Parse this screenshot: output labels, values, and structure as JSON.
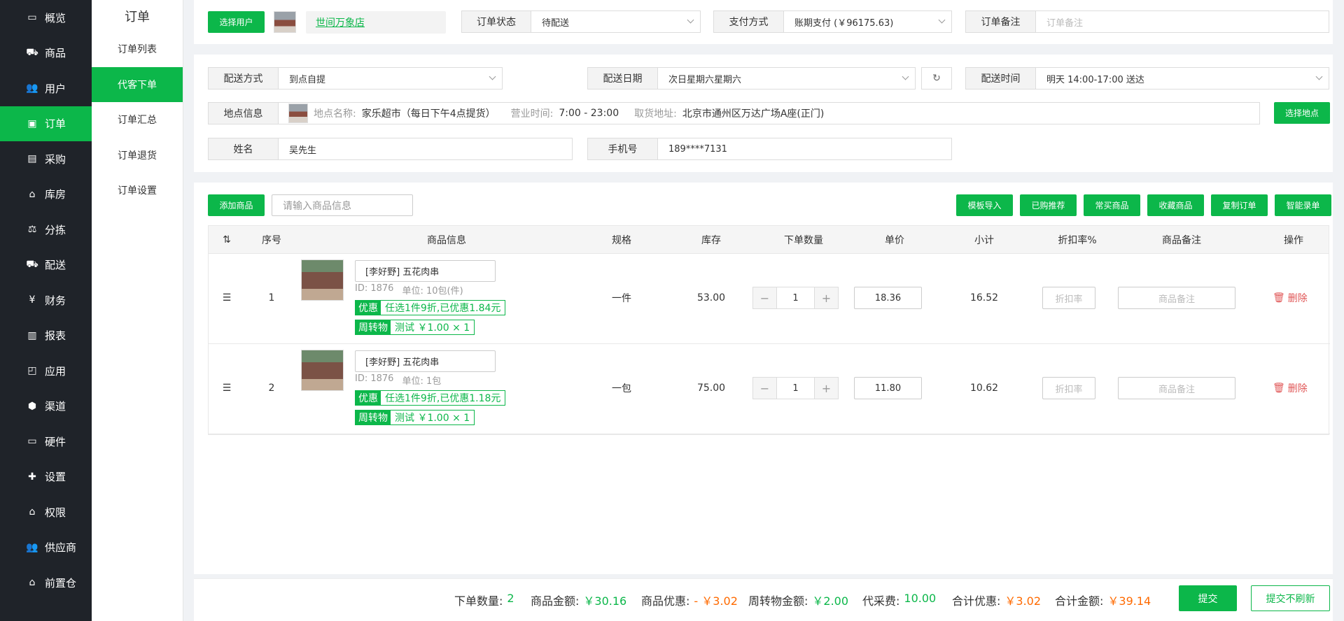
{
  "nav": {
    "items": [
      {
        "label": "概览",
        "icon": "monitor-icon"
      },
      {
        "label": "商品",
        "icon": "cart-icon"
      },
      {
        "label": "用户",
        "icon": "users-icon"
      },
      {
        "label": "订单",
        "icon": "order-icon"
      },
      {
        "label": "采购",
        "icon": "purchase-icon"
      },
      {
        "label": "库房",
        "icon": "warehouse-icon"
      },
      {
        "label": "分拣",
        "icon": "scale-icon"
      },
      {
        "label": "配送",
        "icon": "truck-icon"
      },
      {
        "label": "财务",
        "icon": "yen-icon"
      },
      {
        "label": "报表",
        "icon": "chart-icon"
      },
      {
        "label": "应用",
        "icon": "apps-icon"
      },
      {
        "label": "渠道",
        "icon": "cube-icon"
      },
      {
        "label": "硬件",
        "icon": "desktop-icon"
      },
      {
        "label": "设置",
        "icon": "puzzle-icon"
      },
      {
        "label": "权限",
        "icon": "bank-icon"
      },
      {
        "label": "供应商",
        "icon": "supplier-icon"
      },
      {
        "label": "前置仓",
        "icon": "house-icon"
      }
    ],
    "active_index": 3
  },
  "subnav": {
    "title": "订单",
    "items": [
      "订单列表",
      "代客下单",
      "订单汇总",
      "订单退货",
      "订单设置"
    ],
    "active_index": 1
  },
  "top": {
    "select_user": "选择用户",
    "store": "世间万象店",
    "order_status_label": "订单状态",
    "order_status": "待配送",
    "pay_label": "支付方式",
    "pay_value": "账期支付 (￥96175.63)",
    "remark_label": "订单备注",
    "remark_placeholder": "订单备注"
  },
  "delivery": {
    "method_label": "配送方式",
    "method": "到点自提",
    "date_label": "配送日期",
    "date": "次日星期六星期六",
    "time_label": "配送时间",
    "time": "明天 14:00-17:00 送达",
    "loc_label": "地点信息",
    "loc_name_label": "地点名称:",
    "loc_name": "家乐超市（每日下午4点提货）",
    "hours_label": "营业时间:",
    "hours": "7:00 - 23:00",
    "addr_label": "取货地址:",
    "addr": "北京市通州区万达广场A座(正门)",
    "choose_loc": "选择地点",
    "name_label": "姓名",
    "name": "吴先生",
    "phone_label": "手机号",
    "phone": "189****7131"
  },
  "goods": {
    "add": "添加商品",
    "search_placeholder": "请输入商品信息",
    "actions": [
      "模板导入",
      "已购推荐",
      "常买商品",
      "收藏商品",
      "复制订单",
      "智能录单"
    ],
    "headers": [
      "序号",
      "商品信息",
      "规格",
      "库存",
      "下单数量",
      "单价",
      "小计",
      "折扣率%",
      "商品备注",
      "操作"
    ],
    "rows": [
      {
        "no": "1",
        "name": "[李好野] 五花肉串",
        "id": "ID:  1876",
        "unit": "单位:  10包(件)",
        "promo_tag": "优惠",
        "promo": "任选1件9折,已优惠1.84元",
        "turn_tag": "周转物",
        "turn": "测试  ￥1.00 × 1",
        "spec": "一件",
        "stock": "53.00",
        "qty": "1",
        "price": "18.36",
        "subtotal": "16.52",
        "discount_placeholder": "折扣率",
        "remark_placeholder": "商品备注",
        "delete": "删除"
      },
      {
        "no": "2",
        "name": "[李好野] 五花肉串",
        "id": "ID:  1876",
        "unit": "单位:  1包",
        "promo_tag": "优惠",
        "promo": "任选1件9折,已优惠1.18元",
        "turn_tag": "周转物",
        "turn": "测试  ￥1.00 × 1",
        "spec": "一包",
        "stock": "75.00",
        "qty": "1",
        "price": "11.80",
        "subtotal": "10.62",
        "discount_placeholder": "折扣率",
        "remark_placeholder": "商品备注",
        "delete": "删除"
      }
    ]
  },
  "footer": {
    "qty_label": "下单数量:",
    "qty": "2",
    "amount_label": "商品金额:",
    "amount": "￥30.16",
    "disc_label": "商品优惠:",
    "disc": "- ￥3.02",
    "turn_label": "周转物金额:",
    "turn": "￥2.00",
    "fee_label": "代采费:",
    "fee": "10.00",
    "total_disc_label": "合计优惠:",
    "total_disc": "￥3.02",
    "total_label": "合计金额:",
    "total": "￥39.14",
    "submit": "提交",
    "submit_norefresh": "提交不刷新"
  },
  "colors": {
    "accent": "#0cb74a",
    "nav_bg": "#1f2329",
    "danger": "#e05656",
    "orange": "#ff6a00"
  }
}
